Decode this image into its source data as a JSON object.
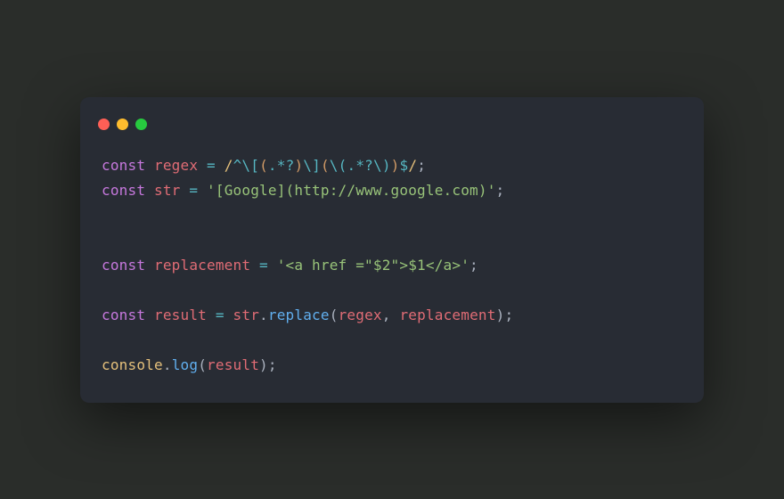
{
  "dots": {
    "red": "#ff5f56",
    "yellow": "#ffbd2e",
    "green": "#27c93f"
  },
  "code": {
    "l1": {
      "kw": "const",
      "sp1": " ",
      "name": "regex",
      "sp2": " ",
      "eq": "=",
      "sp3": " ",
      "r1": "/",
      "r2": "^",
      "r3": "\\[",
      "r4": "(",
      "r5": ".",
      "r6": "*?",
      "r7": ")",
      "r8": "\\]",
      "r9": "(",
      "r10": "\\(",
      "r11": ".",
      "r12": "*?",
      "r13": "\\)",
      "r14": ")",
      "r15": "$",
      "r16": "/",
      "semi": ";"
    },
    "l2": {
      "kw": "const",
      "sp1": " ",
      "name": "str",
      "sp2": " ",
      "eq": "=",
      "sp3": " ",
      "str": "'[Google](http://www.google.com)'",
      "semi": ";"
    },
    "l3": {
      "kw": "const",
      "sp1": " ",
      "name": "replacement",
      "sp2": " ",
      "eq": "=",
      "sp3": " ",
      "str": "'<a href =\"$2\">$1</a>'",
      "semi": ";"
    },
    "l4": {
      "kw": "const",
      "sp1": " ",
      "name": "result",
      "sp2": " ",
      "eq": "=",
      "sp3": " ",
      "obj": "str",
      "dot": ".",
      "fn": "replace",
      "lp": "(",
      "a1": "regex",
      "comma": ",",
      "sp4": " ",
      "a2": "replacement",
      "rp": ")",
      "semi": ";"
    },
    "l5": {
      "obj": "console",
      "dot": ".",
      "fn": "log",
      "lp": "(",
      "a1": "result",
      "rp": ")",
      "semi": ";"
    }
  }
}
